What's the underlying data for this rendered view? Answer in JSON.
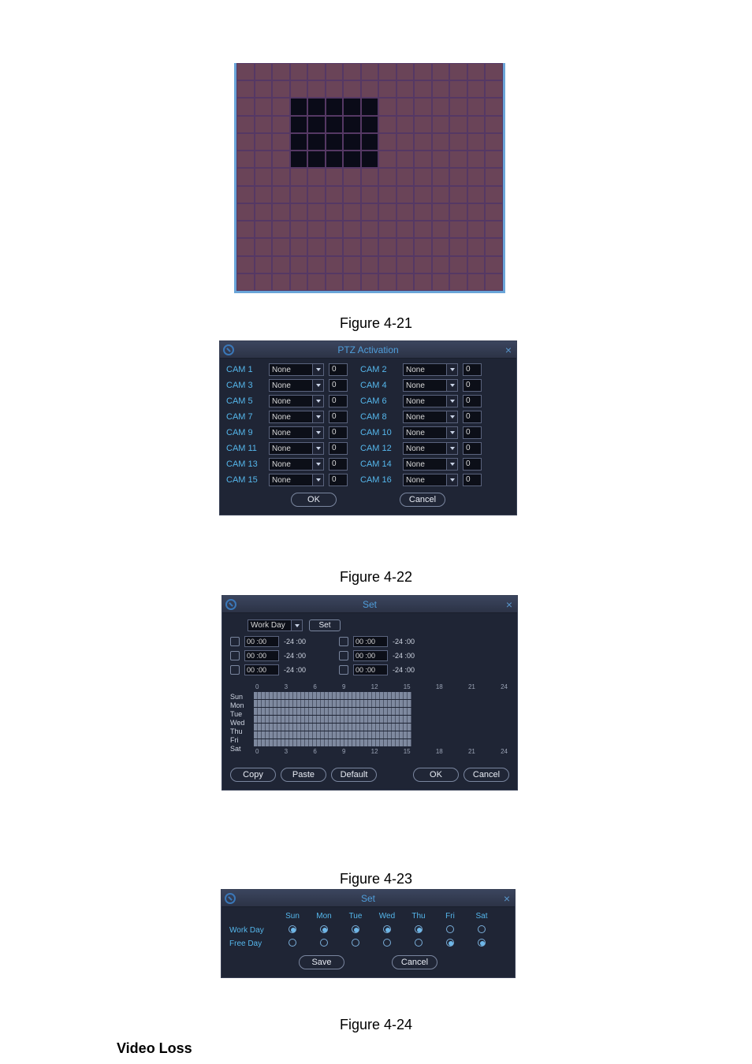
{
  "captions": {
    "fig21": "Figure 4-21",
    "fig22": "Figure 4-22",
    "fig23": "Figure 4-23",
    "fig24": "Figure 4-24"
  },
  "section_heading": "Video Loss",
  "fig22": {
    "title": "PTZ Activation",
    "close": "×",
    "rows": [
      {
        "leftLabel": "CAM 1",
        "leftSelect": "None",
        "leftNum": "0",
        "rightLabel": "CAM 2",
        "rightSelect": "None",
        "rightNum": "0"
      },
      {
        "leftLabel": "CAM 3",
        "leftSelect": "None",
        "leftNum": "0",
        "rightLabel": "CAM 4",
        "rightSelect": "None",
        "rightNum": "0"
      },
      {
        "leftLabel": "CAM 5",
        "leftSelect": "None",
        "leftNum": "0",
        "rightLabel": "CAM 6",
        "rightSelect": "None",
        "rightNum": "0"
      },
      {
        "leftLabel": "CAM 7",
        "leftSelect": "None",
        "leftNum": "0",
        "rightLabel": "CAM 8",
        "rightSelect": "None",
        "rightNum": "0"
      },
      {
        "leftLabel": "CAM 9",
        "leftSelect": "None",
        "leftNum": "0",
        "rightLabel": "CAM 10",
        "rightSelect": "None",
        "rightNum": "0"
      },
      {
        "leftLabel": "CAM 11",
        "leftSelect": "None",
        "leftNum": "0",
        "rightLabel": "CAM 12",
        "rightSelect": "None",
        "rightNum": "0"
      },
      {
        "leftLabel": "CAM 13",
        "leftSelect": "None",
        "leftNum": "0",
        "rightLabel": "CAM 14",
        "rightSelect": "None",
        "rightNum": "0"
      },
      {
        "leftLabel": "CAM 15",
        "leftSelect": "None",
        "leftNum": "0",
        "rightLabel": "CAM 16",
        "rightSelect": "None",
        "rightNum": "0"
      }
    ],
    "buttons": {
      "ok": "OK",
      "cancel": "Cancel"
    }
  },
  "fig23": {
    "title": "Set",
    "close": "×",
    "workday_select": "Work Day",
    "workday_set_btn": "Set",
    "timeRows": [
      {
        "l_start": "00 :00",
        "l_end": "-24 :00",
        "r_start": "00 :00",
        "r_end": "-24 :00"
      },
      {
        "l_start": "00 :00",
        "l_end": "-24 :00",
        "r_start": "00 :00",
        "r_end": "-24 :00"
      },
      {
        "l_start": "00 :00",
        "l_end": "-24 :00",
        "r_start": "00 :00",
        "r_end": "-24 :00"
      }
    ],
    "ticks": [
      "0",
      "3",
      "6",
      "9",
      "12",
      "15",
      "18",
      "21",
      "24"
    ],
    "days": [
      "Sun",
      "Mon",
      "Tue",
      "Wed",
      "Thu",
      "Fri",
      "Sat"
    ],
    "buttons": {
      "copy": "Copy",
      "paste": "Paste",
      "default": "Default",
      "ok": "OK",
      "cancel": "Cancel"
    }
  },
  "fig24": {
    "title": "Set",
    "close": "×",
    "dayHeaders": [
      "Sun",
      "Mon",
      "Tue",
      "Wed",
      "Thu",
      "Fri",
      "Sat"
    ],
    "rows": [
      {
        "label": "Work Day",
        "states": [
          "filled",
          "filled",
          "filled",
          "filled",
          "filled",
          "empty",
          "empty"
        ]
      },
      {
        "label": "Free Day",
        "states": [
          "empty",
          "empty",
          "empty",
          "empty",
          "empty",
          "filled",
          "filled"
        ]
      }
    ],
    "buttons": {
      "save": "Save",
      "cancel": "Cancel"
    }
  }
}
